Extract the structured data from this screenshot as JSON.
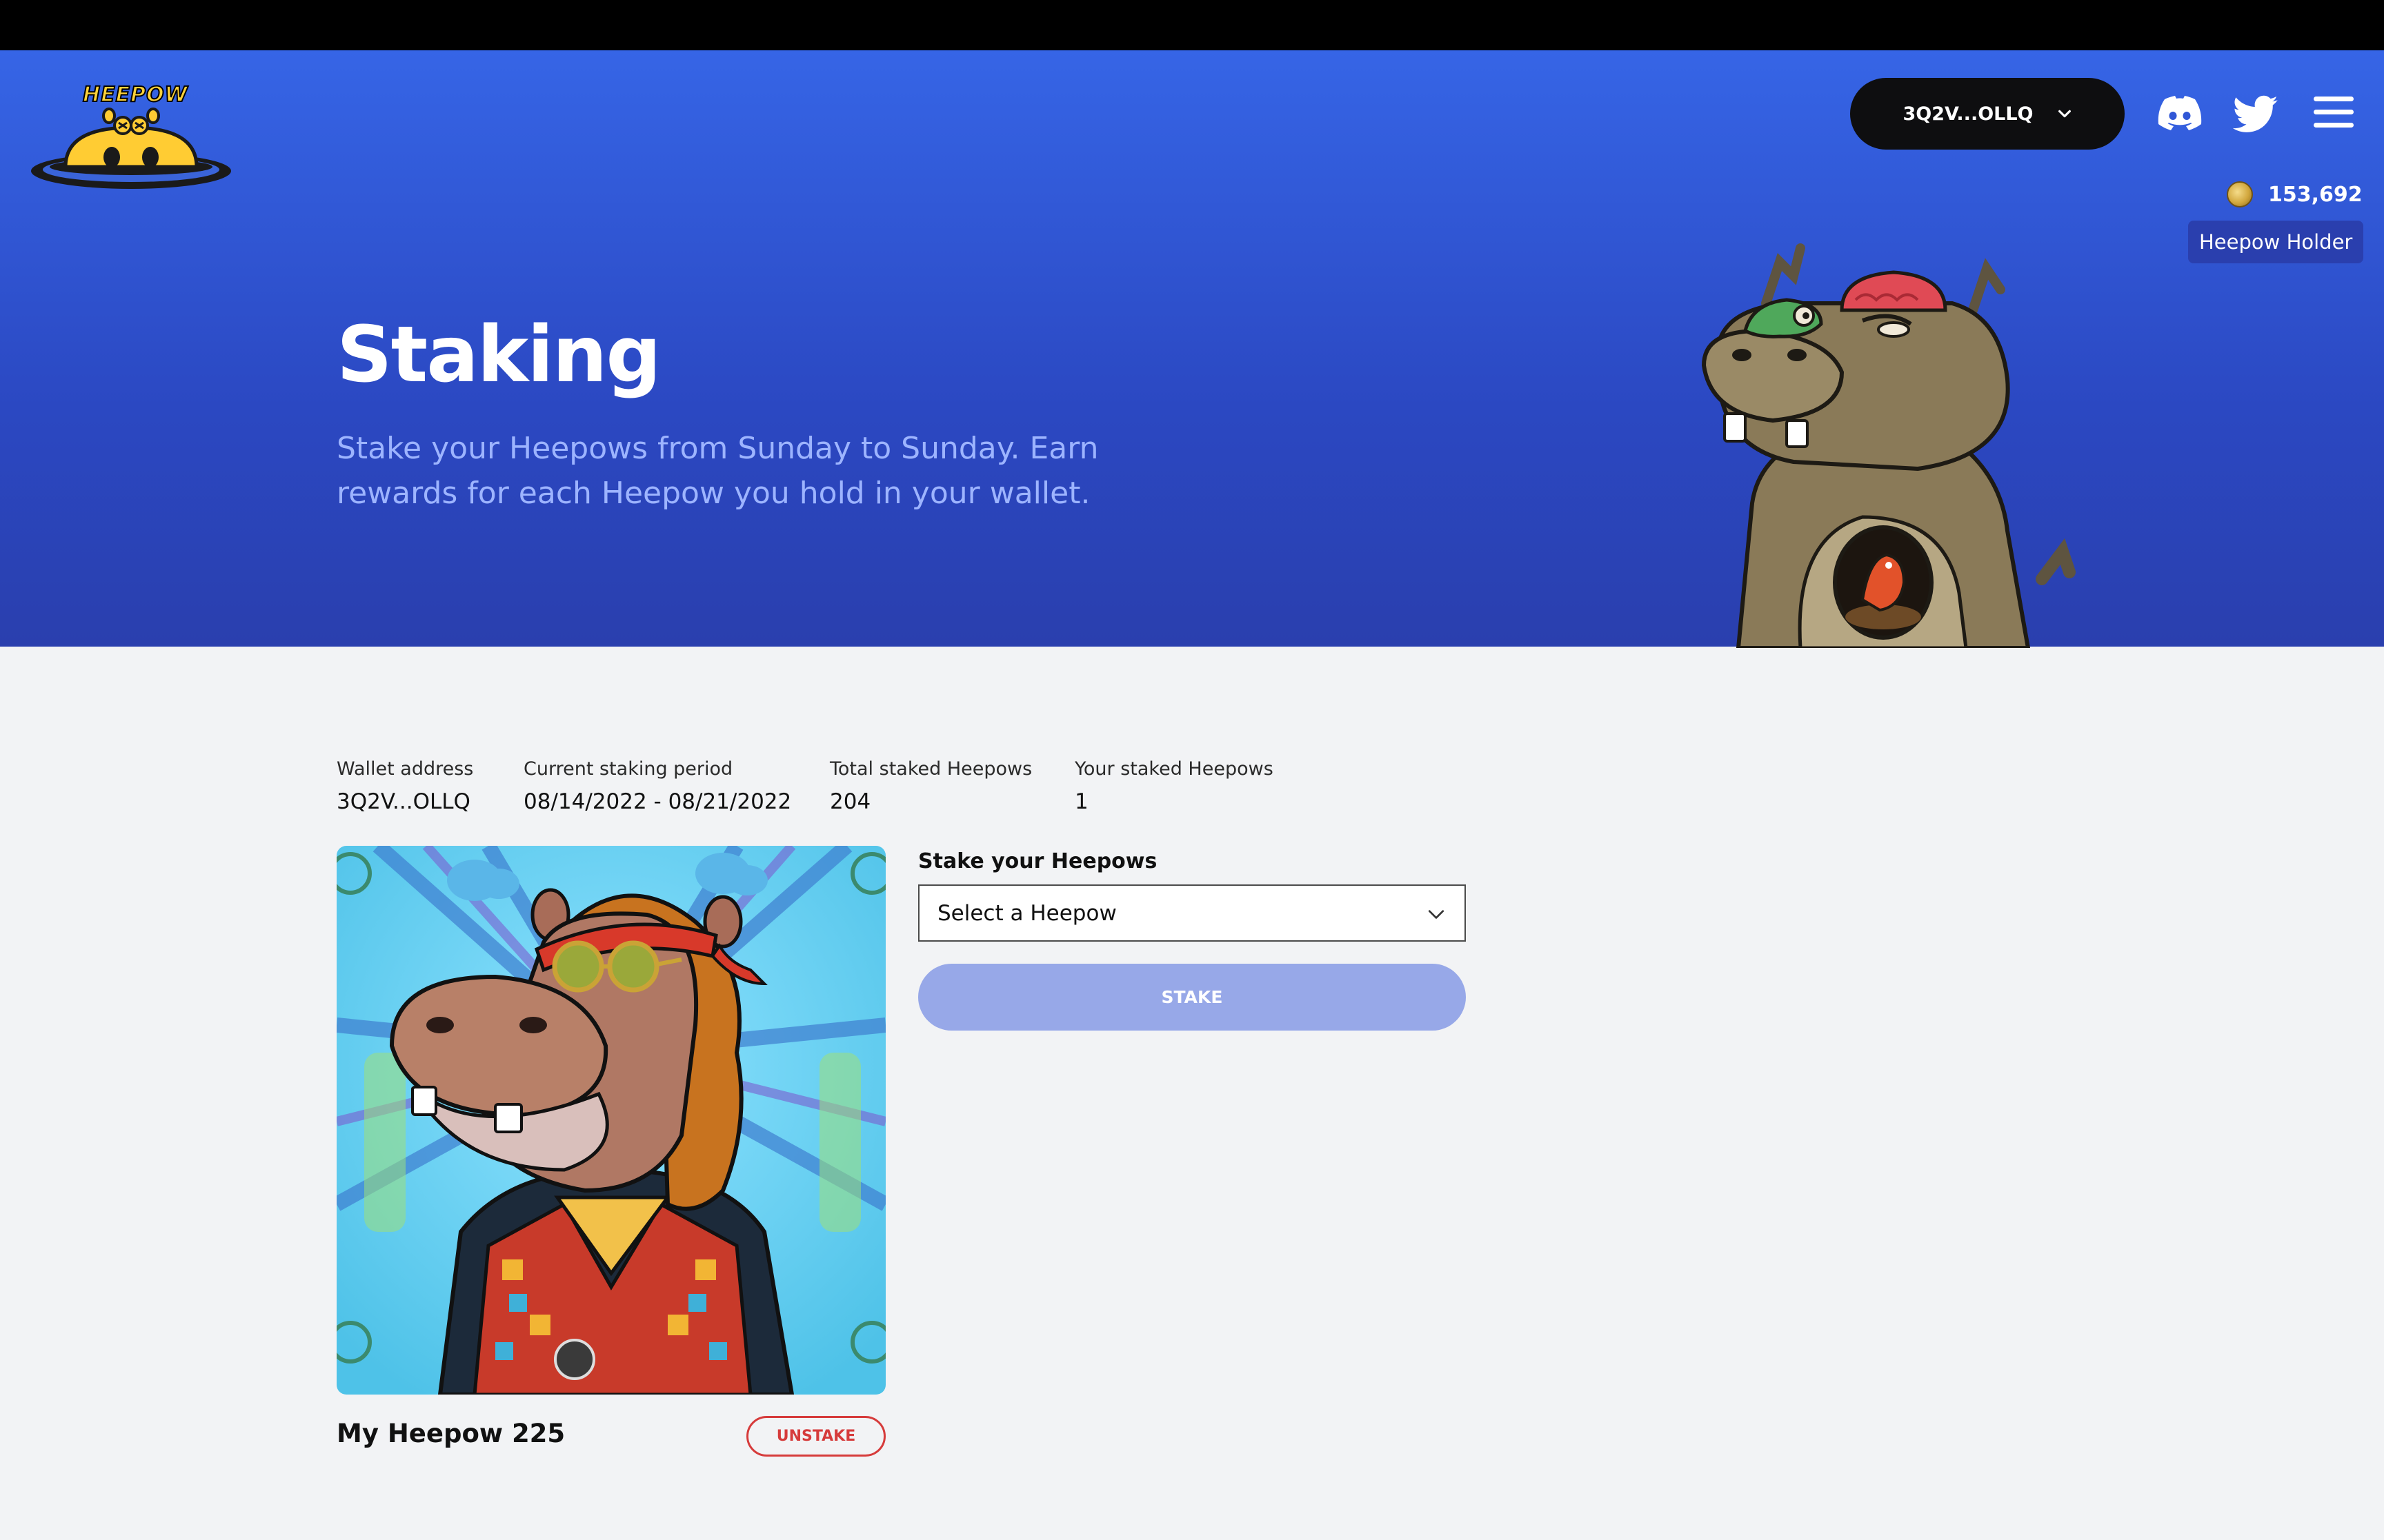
{
  "header": {
    "logo_text": "HEEPOW",
    "wallet_button_label": "3Q2V...OLLQ",
    "icons": [
      "discord-icon",
      "twitter-icon",
      "menu-icon",
      "chevron-down-icon",
      "coin-icon"
    ],
    "balance": "153,692",
    "holder_badge": "Heepow Holder"
  },
  "hero": {
    "title": "Staking",
    "subtitle": "Stake your Heepows from Sunday to Sunday. Earn rewards for each Heepow you hold in your wallet."
  },
  "stats": [
    {
      "label": "Wallet address",
      "value": "3Q2V...OLLQ"
    },
    {
      "label": "Current staking period",
      "value": "08/14/2022 - 08/21/2022"
    },
    {
      "label": "Total staked Heepows",
      "value": "204"
    },
    {
      "label": "Your staked Heepows",
      "value": "1"
    }
  ],
  "nft": {
    "name": "My Heepow 225",
    "unstake_label": "UNSTAKE"
  },
  "stake_form": {
    "label": "Stake your Heepows",
    "select_value": "Select a Heepow",
    "stake_button_label": "STAKE"
  },
  "colors": {
    "hero_top": "#3665e6",
    "hero_bottom": "#2a3fae",
    "stake_button": "#97a8e8",
    "unstake_red": "#d63b3b",
    "page_bg": "#f2f3f5"
  }
}
